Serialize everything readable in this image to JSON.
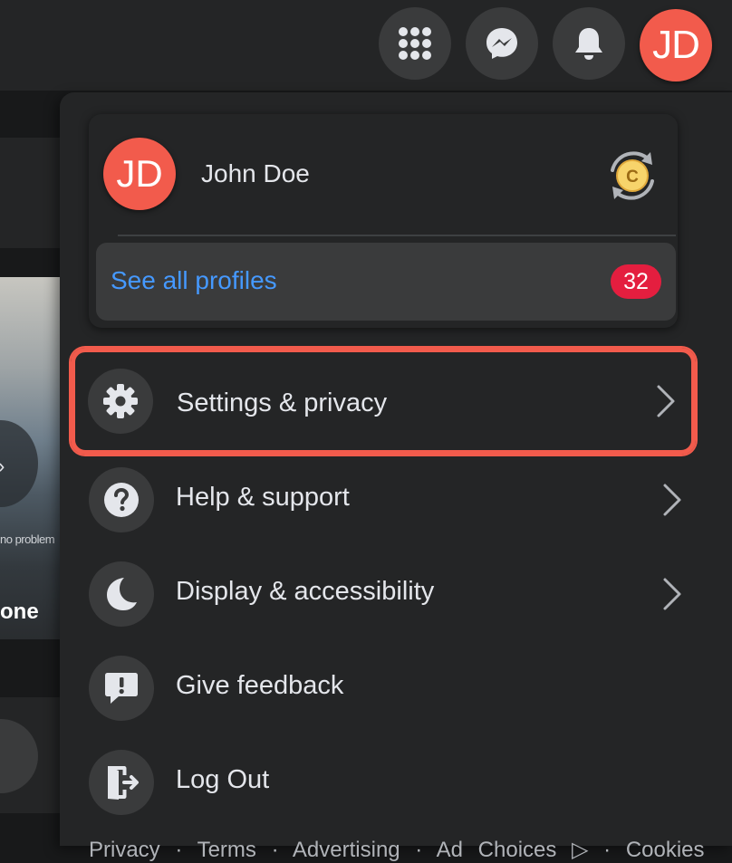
{
  "header": {
    "apps_icon": "menu-grid-icon",
    "messenger_icon": "messenger-icon",
    "notifications_icon": "bell-icon",
    "account_initials": "JD"
  },
  "feed": {
    "caption": "no problem",
    "title": "one"
  },
  "account_menu": {
    "profile": {
      "initials": "JD",
      "name": "John Doe",
      "switch_icon": "switch-profile-icon"
    },
    "see_all_profiles": {
      "label": "See all profiles",
      "badge_count": "32"
    },
    "items": [
      {
        "label": "Settings & privacy",
        "icon": "gear-icon",
        "has_submenu": true,
        "highlighted": true
      },
      {
        "label": "Help & support",
        "icon": "question-icon",
        "has_submenu": true
      },
      {
        "label": "Display & accessibility",
        "icon": "moon-icon",
        "has_submenu": true
      },
      {
        "label": "Give feedback",
        "icon": "feedback-icon",
        "has_submenu": false
      },
      {
        "label": "Log Out",
        "icon": "logout-icon",
        "has_submenu": false
      }
    ],
    "footer": "Privacy · Terms · Advertising · Ad Choices ▷ · Cookies"
  },
  "colors": {
    "background": "#18191a",
    "surface": "#242526",
    "icon_circle": "#3a3b3c",
    "avatar": "#f25b4c",
    "link_blue": "#4599ff",
    "badge_red": "#e41e3f",
    "highlight_outline": "#f25b4c",
    "text_primary": "#e4e6eb",
    "text_secondary": "#b0b3b8"
  }
}
